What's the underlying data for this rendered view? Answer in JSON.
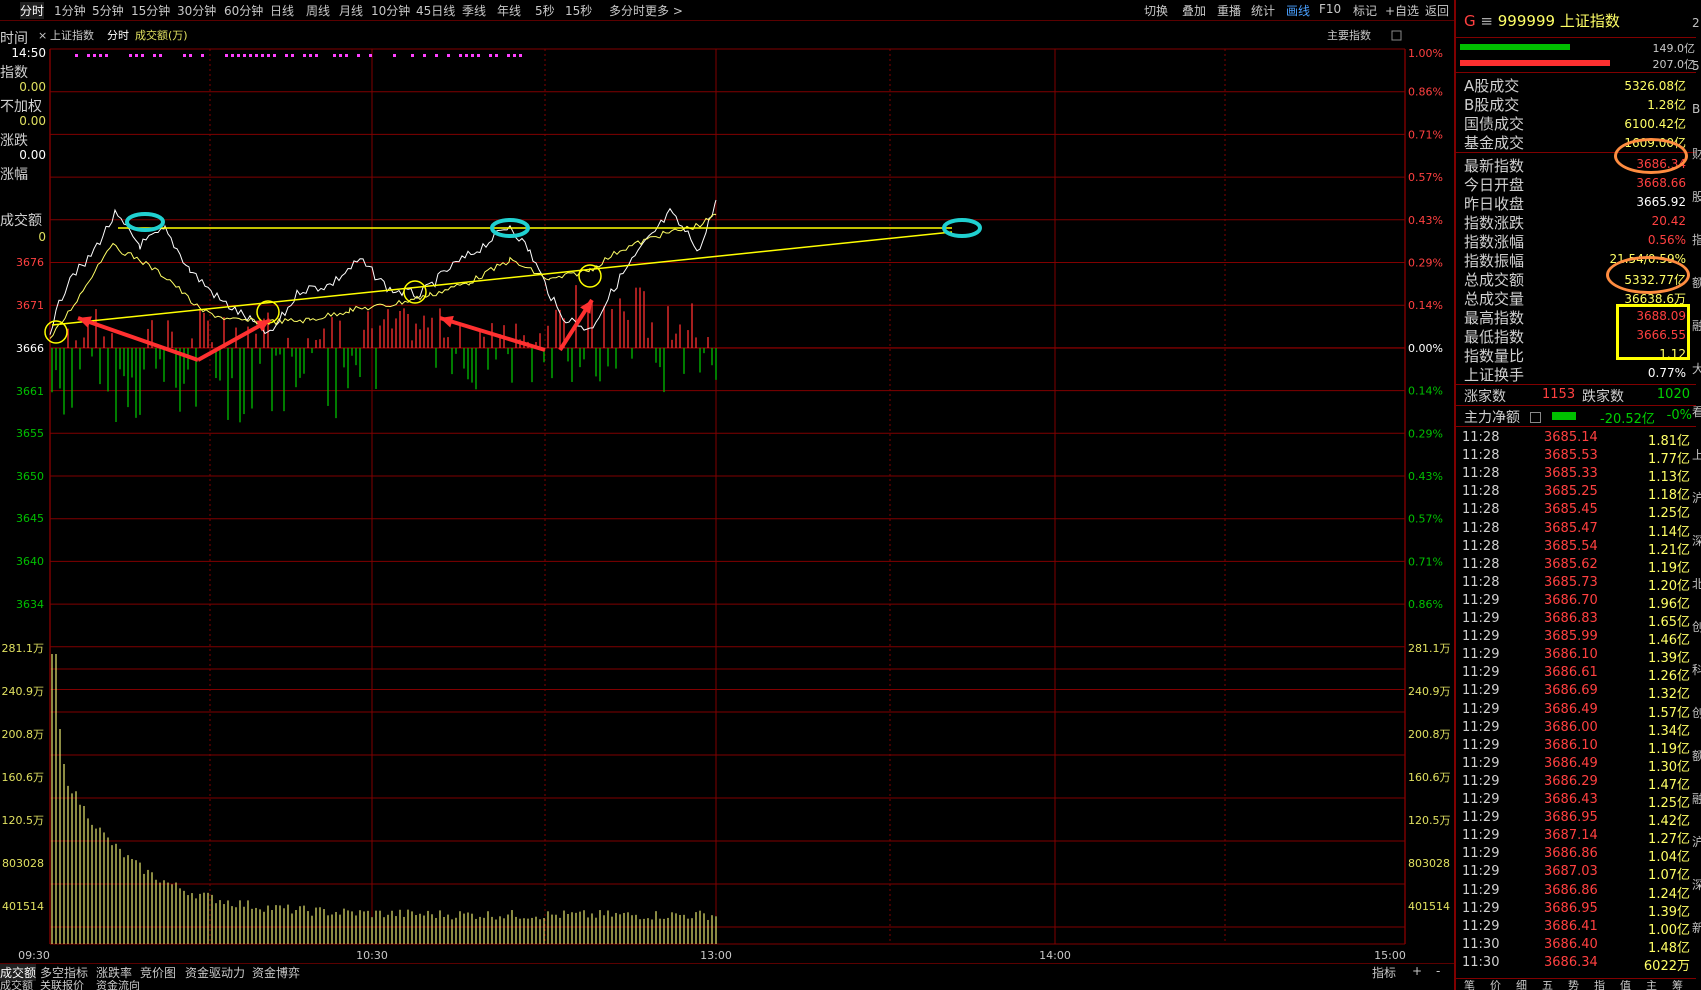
{
  "toolbar": {
    "left_items": [
      "分时",
      "1分钟",
      "5分钟",
      "15分钟",
      "30分钟",
      "60分钟",
      "日线",
      "周线",
      "月线",
      "10分钟",
      "45日线",
      "季线",
      "年线",
      "5秒",
      "15秒",
      "多分时",
      "更多"
    ],
    "right_items": [
      "切换",
      "叠加",
      "重播",
      "统计",
      "画线",
      "F10",
      "标记",
      "+自选",
      "返回"
    ]
  },
  "chart_header": {
    "index_name": "上证指数",
    "mode": "分时",
    "indicator": "成交额(万)",
    "main_index_label": "主要指数",
    "time": "14:50"
  },
  "left_info": {
    "labels": [
      "时间",
      "指数",
      "不加权",
      "涨跌",
      "涨幅",
      "成交额"
    ],
    "values": [
      "0.00",
      "0.00",
      "0.00",
      "0"
    ]
  },
  "price_axis": {
    "left": [
      "3676",
      "3671",
      "3666",
      "3661",
      "3655",
      "3650",
      "3645",
      "3640",
      "3634"
    ],
    "right": [
      "1.00%",
      "0.86%",
      "0.71%",
      "0.57%",
      "0.43%",
      "0.29%",
      "0.14%",
      "0.00%",
      "0.14%",
      "0.29%",
      "0.43%",
      "0.57%",
      "0.71%",
      "0.86%"
    ]
  },
  "volume_axis": {
    "labels": [
      "281.1万",
      "240.9万",
      "200.8万",
      "160.6万",
      "120.5万",
      "803028",
      "401514"
    ]
  },
  "time_axis": {
    "labels": [
      "09:30",
      "10:30",
      "13:00",
      "14:00",
      "15:00"
    ]
  },
  "bottom_tabs": [
    "成交额",
    "多空指标",
    "涨跌率",
    "竞价图",
    "资金驱动力",
    "资金博弈"
  ],
  "bottom_right": [
    "指标",
    "+",
    "-"
  ],
  "bottom_tabs2": [
    "成交额",
    "关联报价",
    "资金流向"
  ],
  "right_panel": {
    "code": "999999",
    "name": "上证指数",
    "prefix": "G",
    "bar_values": [
      "149.0亿",
      "207.0亿"
    ],
    "stats1": [
      {
        "k": "A股成交",
        "v": "5326.08亿"
      },
      {
        "k": "B股成交",
        "v": "1.28亿"
      },
      {
        "k": "国债成交",
        "v": "6100.42亿"
      },
      {
        "k": "基金成交",
        "v": "1609.00亿"
      }
    ],
    "stats2": [
      {
        "k": "最新指数",
        "v": "3686.34",
        "c": "#ff4040"
      },
      {
        "k": "今日开盘",
        "v": "3668.66",
        "c": "#ff4040"
      },
      {
        "k": "昨日收盘",
        "v": "3665.92",
        "c": "#ffffff"
      },
      {
        "k": "指数涨跌",
        "v": "20.42",
        "c": "#ff4040"
      },
      {
        "k": "指数涨幅",
        "v": "0.56%",
        "c": "#ff4040"
      },
      {
        "k": "指数振幅",
        "v": "21.54/0.59%",
        "c": "#ffff66"
      },
      {
        "k": "总成交额",
        "v": "5332.77亿",
        "c": "#ffff66"
      },
      {
        "k": "总成交量",
        "v": "36638.6万",
        "c": "#ffff66"
      },
      {
        "k": "最高指数",
        "v": "3688.09",
        "c": "#ff4040"
      },
      {
        "k": "最低指数",
        "v": "3666.55",
        "c": "#ff4040"
      },
      {
        "k": "指数量比",
        "v": "1.12",
        "c": "#ffff66"
      },
      {
        "k": "上证换手",
        "v": "0.77%",
        "c": "#ffffff"
      }
    ],
    "updown": {
      "up_label": "涨家数",
      "up": "1153",
      "down_label": "跌家数",
      "down": "1020"
    },
    "mainforce": {
      "label": "主力净额",
      "value": "-20.52亿",
      "pct": "-0%"
    },
    "ticks": [
      {
        "t": "11:28",
        "p": "3685.14",
        "a": "1.81亿"
      },
      {
        "t": "11:28",
        "p": "3685.53",
        "a": "1.77亿"
      },
      {
        "t": "11:28",
        "p": "3685.33",
        "a": "1.13亿"
      },
      {
        "t": "11:28",
        "p": "3685.25",
        "a": "1.18亿"
      },
      {
        "t": "11:28",
        "p": "3685.45",
        "a": "1.25亿"
      },
      {
        "t": "11:28",
        "p": "3685.47",
        "a": "1.14亿"
      },
      {
        "t": "11:28",
        "p": "3685.54",
        "a": "1.21亿"
      },
      {
        "t": "11:28",
        "p": "3685.62",
        "a": "1.19亿"
      },
      {
        "t": "11:28",
        "p": "3685.73",
        "a": "1.20亿"
      },
      {
        "t": "11:29",
        "p": "3686.70",
        "a": "1.96亿"
      },
      {
        "t": "11:29",
        "p": "3686.83",
        "a": "1.65亿"
      },
      {
        "t": "11:29",
        "p": "3685.99",
        "a": "1.46亿"
      },
      {
        "t": "11:29",
        "p": "3686.10",
        "a": "1.39亿"
      },
      {
        "t": "11:29",
        "p": "3686.61",
        "a": "1.26亿"
      },
      {
        "t": "11:29",
        "p": "3686.69",
        "a": "1.32亿"
      },
      {
        "t": "11:29",
        "p": "3686.49",
        "a": "1.57亿"
      },
      {
        "t": "11:29",
        "p": "3686.00",
        "a": "1.34亿"
      },
      {
        "t": "11:29",
        "p": "3686.10",
        "a": "1.19亿"
      },
      {
        "t": "11:29",
        "p": "3686.49",
        "a": "1.30亿"
      },
      {
        "t": "11:29",
        "p": "3686.29",
        "a": "1.47亿"
      },
      {
        "t": "11:29",
        "p": "3686.43",
        "a": "1.25亿"
      },
      {
        "t": "11:29",
        "p": "3686.95",
        "a": "1.42亿"
      },
      {
        "t": "11:29",
        "p": "3687.14",
        "a": "1.27亿"
      },
      {
        "t": "11:29",
        "p": "3686.86",
        "a": "1.04亿"
      },
      {
        "t": "11:29",
        "p": "3687.03",
        "a": "1.07亿"
      },
      {
        "t": "11:29",
        "p": "3686.86",
        "a": "1.24亿"
      },
      {
        "t": "11:29",
        "p": "3686.95",
        "a": "1.39亿"
      },
      {
        "t": "11:29",
        "p": "3686.41",
        "a": "1.00亿"
      },
      {
        "t": "11:30",
        "p": "3686.40",
        "a": "1.48亿"
      },
      {
        "t": "11:30",
        "p": "3686.34",
        "a": "6022万"
      }
    ],
    "bottom_tabs": [
      "笔",
      "价",
      "细",
      "五",
      "势",
      "指",
      "值",
      "主",
      "筹"
    ]
  },
  "edge_chars": [
    "2",
    "5",
    "B",
    "财",
    "股",
    "指",
    "额",
    "融",
    "大",
    "看",
    "上",
    "沪",
    "深",
    "北",
    "创",
    "科",
    "创",
    "额",
    "融",
    "沪",
    "深",
    "新"
  ],
  "colors": {
    "up": "#ff4040",
    "down": "#00c000",
    "axis": "#800000",
    "price": "#ffffff",
    "avg": "#ffff66"
  }
}
